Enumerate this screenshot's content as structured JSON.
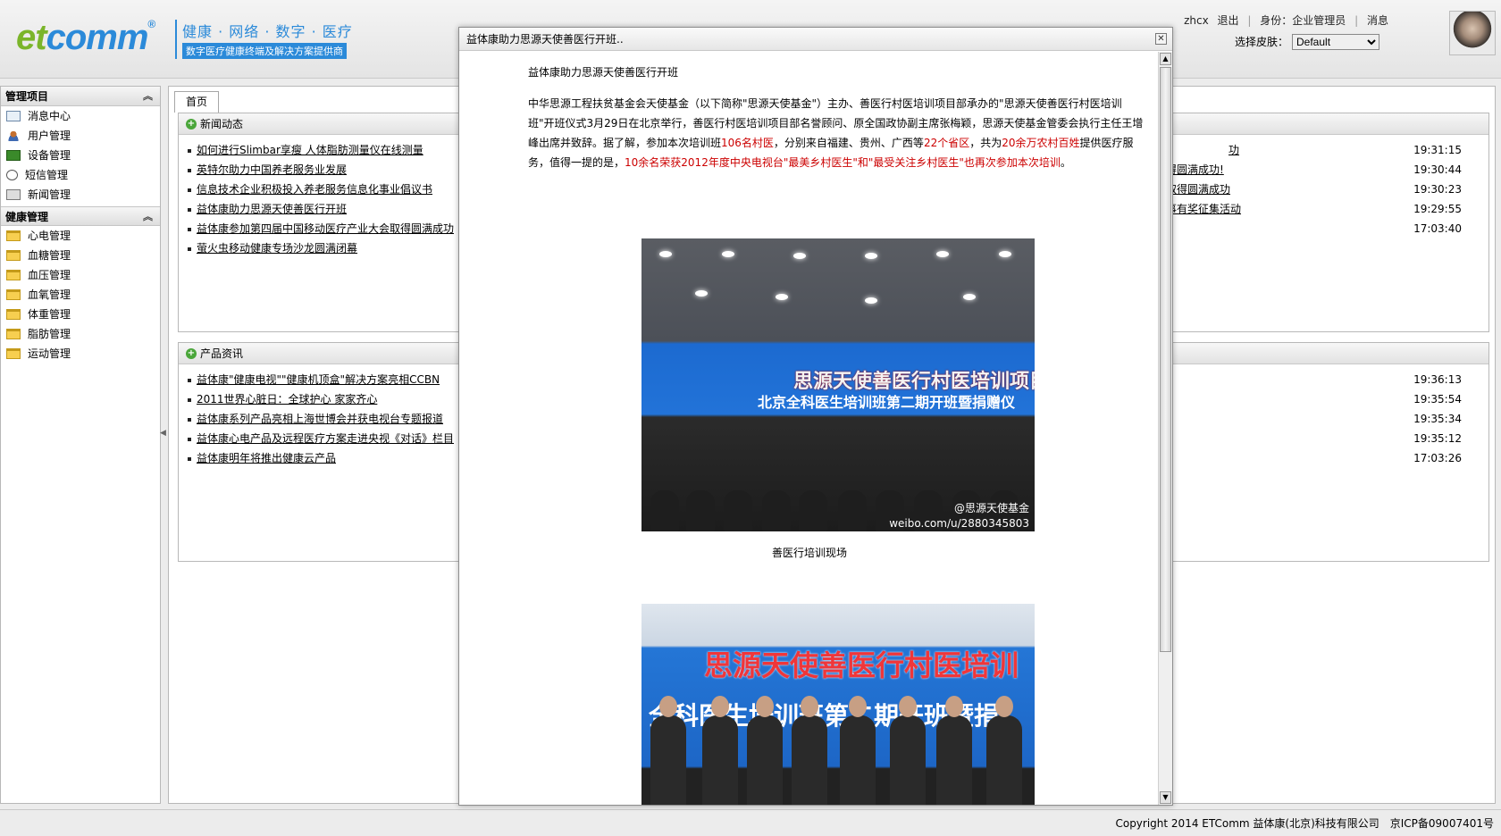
{
  "header": {
    "logo_et": "et",
    "logo_comm": "comm",
    "logo_reg": "®",
    "slogan_line1": "健康 · 网络 · 数字 · 医疗",
    "slogan_line2": "数字医疗健康终端及解决方案提供商",
    "username": "zhcx",
    "logout": "退出",
    "sep": "|",
    "role": "身份：企业管理员",
    "messages": "消息",
    "skin_label": "选择皮肤：",
    "skin_value": "Default"
  },
  "sidebar": {
    "section1_title": "管理项目",
    "section1_items": [
      {
        "label": "消息中心",
        "icon": "message-icon"
      },
      {
        "label": "用户管理",
        "icon": "user-icon"
      },
      {
        "label": "设备管理",
        "icon": "device-icon"
      },
      {
        "label": "短信管理",
        "icon": "sms-icon"
      },
      {
        "label": "新闻管理",
        "icon": "news-icon"
      }
    ],
    "section2_title": "健康管理",
    "section2_items": [
      {
        "label": "心电管理",
        "icon": "folder-icon"
      },
      {
        "label": "血糖管理",
        "icon": "folder-icon"
      },
      {
        "label": "血压管理",
        "icon": "folder-icon"
      },
      {
        "label": "血氧管理",
        "icon": "folder-icon"
      },
      {
        "label": "体重管理",
        "icon": "folder-icon"
      },
      {
        "label": "脂肪管理",
        "icon": "folder-icon"
      },
      {
        "label": "运动管理",
        "icon": "folder-icon"
      }
    ]
  },
  "main": {
    "tab_home": "首页",
    "news_panel": {
      "title": "新闻动态",
      "items": [
        "如何进行Slimbar享瘦 人体脂肪测量仪在线测量",
        "英特尔助力中国养老服务业发展",
        "信息技术企业积极投入养老服务信息化事业倡议书",
        "益体康助力思源天使善医行开班",
        "益体康参加第四届中国移动医疗产业大会取得圆满成功",
        "萤火虫移动健康专场沙龙圆满闭幕"
      ],
      "partial": [
        "功",
        "览会展出取得圆满成功!",
        "展览会展出取得圆满成功",
        "乡村医生故事有奖征集活动"
      ],
      "times": [
        "19:31:15",
        "19:30:44",
        "19:30:23",
        "19:29:55",
        "17:03:40"
      ]
    },
    "product_panel": {
      "title": "产品资讯",
      "items": [
        "益体康\"健康电视\"\"健康机顶盒\"解决方案亮相CCBN",
        "2011世界心脏日：全球护心 家家齐心",
        "益体康系列产品亮相上海世博会并获电视台专题报道",
        "益体康心电产品及远程医疗方案走进央视《对话》栏目",
        "益体康明年将推出健康云产品"
      ],
      "times": [
        "19:36:13",
        "19:35:54",
        "19:35:34",
        "19:35:12",
        "17:03:26"
      ]
    }
  },
  "modal": {
    "window_title": "益体康助力思源天使善医行开班..",
    "article_title": "益体康助力思源天使善医行开班",
    "para_a": "中华思源工程扶贫基金会天使基金（以下简称\"思源天使基金\"）主办、善医行村医培训项目部承办的\"思源天使善医行村医培训班\"开班仪式3月29日在北京举行，善医行村医培训项目部名誉顾问、原全国政协副主席张梅颖，思源天使基金管委会执行主任王增峰出席并致辞。据了解，参加本次培训班",
    "para_red1": "106名村医",
    "para_b": "，分别来自福建、贵州、广西等",
    "para_red2": "22个省区",
    "para_c": "，共为",
    "para_red3": "20余万农村百姓",
    "para_d": "提供医疗服务，值得一提的是，",
    "para_red4": "10余名荣获2012年度中央电视台\"最美乡村医生\"和\"最受关注乡村医生\"也再次参加本次培训",
    "para_e": "。",
    "photo1_banner": "思源天使善医行村医培训项目",
    "photo1_banner2": "北京全科医生培训班第二期开班暨捐赠仪",
    "photo1_watermark": "@思源天使基金",
    "photo1_watermark2": "weibo.com/u/2880345803",
    "caption1": "善医行培训现场",
    "photo2_banner": "思源天使善医行村医培训",
    "photo2_banner2": "全科医生培训班第二期开班暨捐"
  },
  "footer": {
    "copyright": "Copyright 2014 ETComm 益体康(北京)科技有限公司　京ICP备09007401号"
  },
  "colors": {
    "accent": "#2b8ad9",
    "logo_green": "#7bb52a",
    "highlight_red": "#cc0000"
  }
}
